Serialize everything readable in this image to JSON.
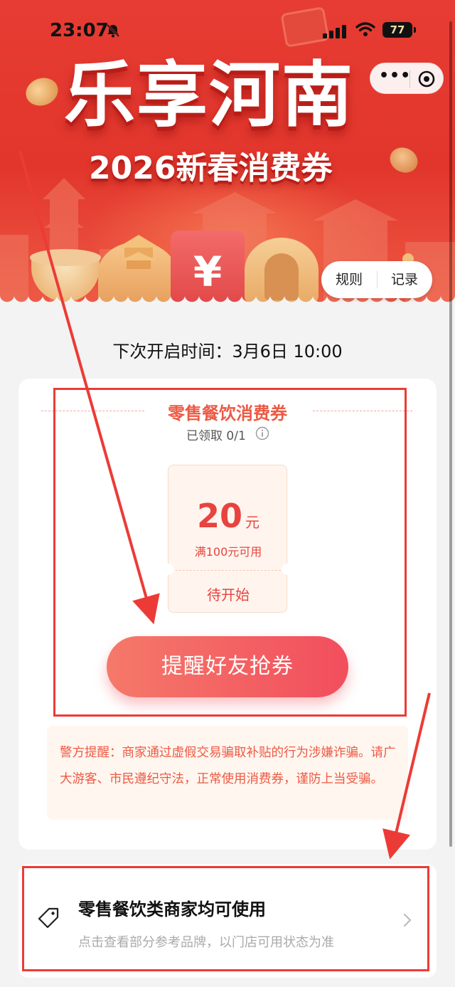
{
  "status_bar": {
    "time": "23:07",
    "battery": "77"
  },
  "banner": {
    "title": "乐享河南",
    "subtitle": "2026新春消费券"
  },
  "actions": {
    "rules": "规则",
    "records": "记录"
  },
  "next_open": "下次开启时间：3月6日 10:00",
  "coupon": {
    "category": "零售餐饮消费券",
    "claimed": "已领取 0/1",
    "amount": "20",
    "unit": "元",
    "condition": "满100元可用",
    "status": "待开始",
    "remind_button": "提醒好友抢券"
  },
  "warning": "警方提醒：商家通过虚假交易骗取补贴的行为涉嫌诈骗。请广大游客、市民遵纪守法，正常使用消费券，谨防上当受骗。",
  "merchant": {
    "title": "零售餐饮类商家均可使用",
    "description": "点击查看部分参考品牌，以门店可用状态为准"
  },
  "colors": {
    "brand_red": "#e73c33",
    "accent": "#ec5a45",
    "annotation": "#ec3b36"
  }
}
